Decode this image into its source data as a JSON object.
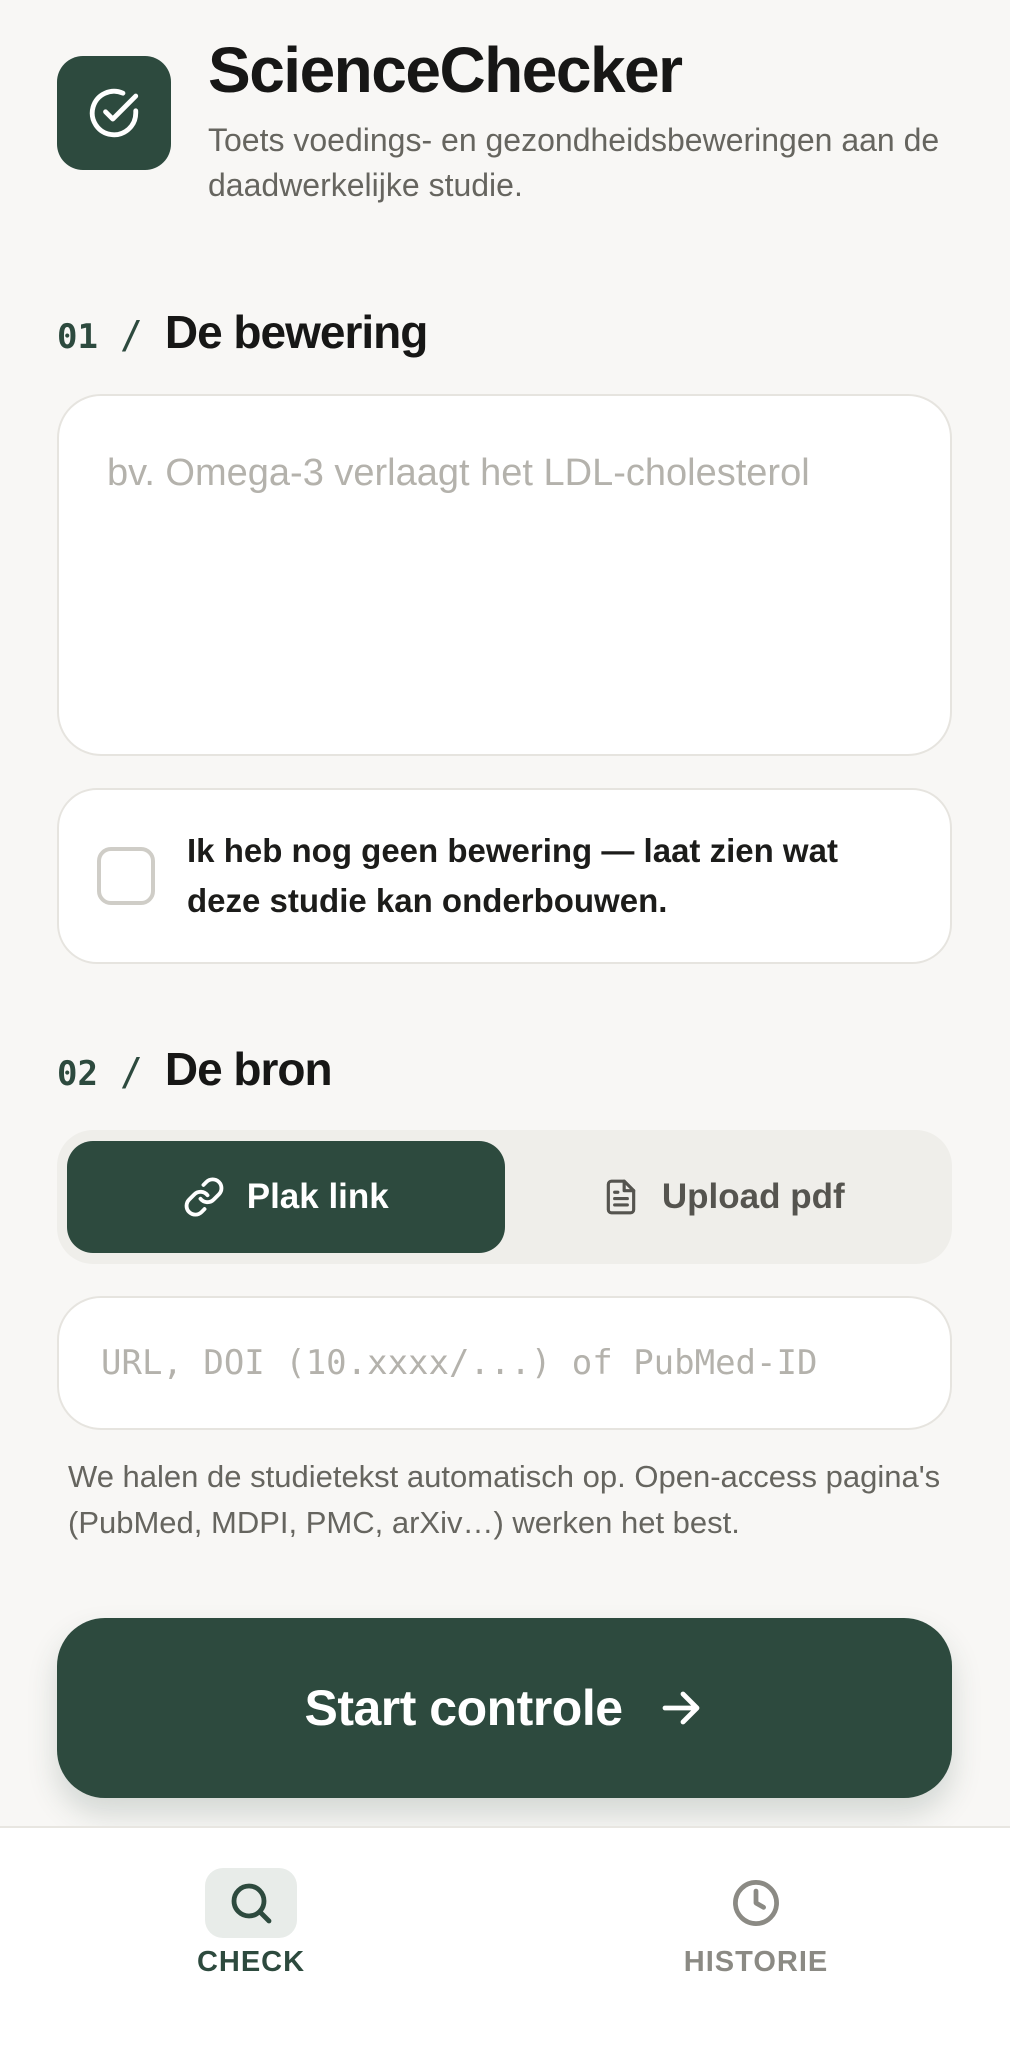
{
  "header": {
    "title": "ScienceChecker",
    "subtitle": "Toets voedings- en gezondheidsbeweringen aan de daadwerkelijke studie.",
    "logo_icon": "check-circle-icon"
  },
  "claim_section": {
    "number": "01",
    "slash": "/",
    "title": "De bewering",
    "placeholder": "bv. Omega-3 verlaagt het LDL-cholesterol",
    "value": "",
    "checkbox_label": "Ik heb nog geen bewering — laat zien wat deze studie kan onderbouwen.",
    "checkbox_checked": false
  },
  "source_section": {
    "number": "02",
    "slash": "/",
    "title": "De bron",
    "tabs": [
      {
        "label": "Plak link",
        "icon": "link-icon",
        "active": true
      },
      {
        "label": "Upload pdf",
        "icon": "document-icon",
        "active": false
      }
    ],
    "url_placeholder": "URL, DOI (10.xxxx/...) of PubMed-ID",
    "url_value": "",
    "hint": "We halen de studietekst automatisch op. Open-access pagina's (PubMed, MDPI, PMC, arXiv…) werken het best."
  },
  "start_button": {
    "label": "Start controle",
    "icon": "arrow-right-icon"
  },
  "bottom_nav": {
    "items": [
      {
        "label": "CHECK",
        "icon": "search-icon",
        "active": true
      },
      {
        "label": "HISTORIE",
        "icon": "clock-icon",
        "active": false
      }
    ]
  },
  "colors": {
    "accent": "#2d4a3e",
    "background": "#f8f7f5",
    "card": "#ffffff",
    "muted_text": "#66655f",
    "placeholder": "#b4b2ac"
  }
}
